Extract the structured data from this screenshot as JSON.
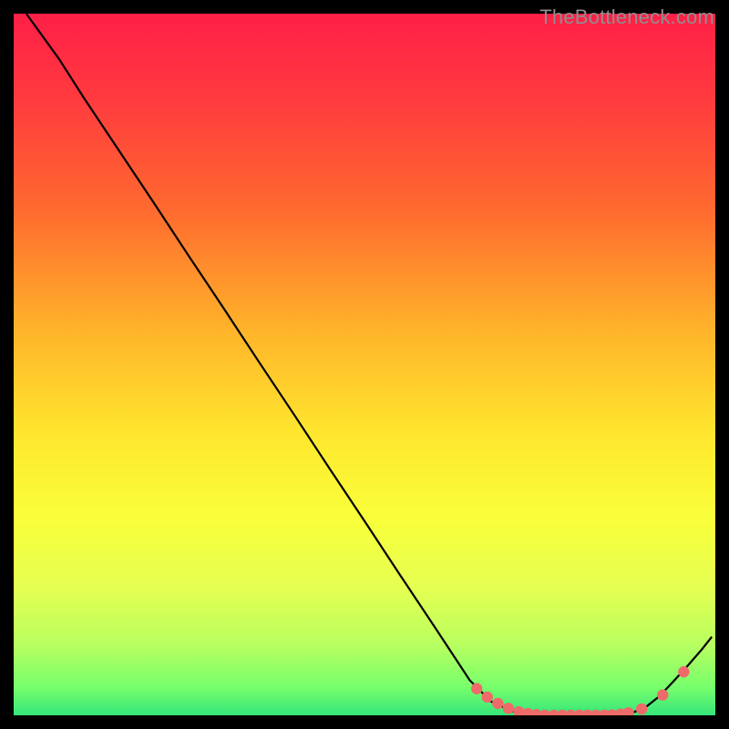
{
  "watermark": "TheBottleneck.com",
  "chart_data": {
    "type": "line",
    "title": "",
    "xlabel": "",
    "ylabel": "",
    "xlim": [
      0,
      100
    ],
    "ylim": [
      0,
      100
    ],
    "grid": false,
    "legend": false,
    "gradient_stops": [
      {
        "offset": 0.0,
        "color": "#ff1f47"
      },
      {
        "offset": 0.12,
        "color": "#ff3a3f"
      },
      {
        "offset": 0.28,
        "color": "#ff6a2f"
      },
      {
        "offset": 0.45,
        "color": "#ffb32a"
      },
      {
        "offset": 0.6,
        "color": "#ffe72e"
      },
      {
        "offset": 0.72,
        "color": "#f9ff3a"
      },
      {
        "offset": 0.82,
        "color": "#e4ff52"
      },
      {
        "offset": 0.9,
        "color": "#b8ff60"
      },
      {
        "offset": 0.96,
        "color": "#77ff6c"
      },
      {
        "offset": 1.0,
        "color": "#35e57a"
      }
    ],
    "series": [
      {
        "name": "bottleneck-curve",
        "type": "line",
        "color": "#000000",
        "x": [
          1.8,
          6.5,
          10,
          15,
          20,
          25,
          30,
          35,
          40,
          45,
          50,
          55,
          60,
          65,
          68,
          71,
          73,
          75,
          78,
          80,
          82,
          84,
          86,
          88,
          90,
          92,
          94,
          96,
          98,
          99.5
        ],
        "y": [
          100,
          93.5,
          88.0,
          80.5,
          73.0,
          65.4,
          57.9,
          50.3,
          42.8,
          35.2,
          27.7,
          20.1,
          12.6,
          5.0,
          2.0,
          0.6,
          0.2,
          0.0,
          0.0,
          0.0,
          0.0,
          0.0,
          0.0,
          0.3,
          1.1,
          2.7,
          4.8,
          7.0,
          9.3,
          11.2
        ]
      },
      {
        "name": "highlighted-points",
        "type": "scatter",
        "color": "#ee6b6a",
        "x": [
          66,
          67.5,
          69,
          70.5,
          72,
          73.3,
          74.5,
          75.7,
          77,
          78.2,
          79.4,
          80.6,
          81.8,
          83,
          84.2,
          85.3,
          86.5,
          87.6,
          89.5,
          92.5,
          95.5
        ],
        "y": [
          3.8,
          2.6,
          1.7,
          1.0,
          0.5,
          0.25,
          0.1,
          0.0,
          0.0,
          0.0,
          0.0,
          0.0,
          0.0,
          0.0,
          0.0,
          0.05,
          0.15,
          0.35,
          0.9,
          2.9,
          6.2
        ]
      }
    ]
  }
}
